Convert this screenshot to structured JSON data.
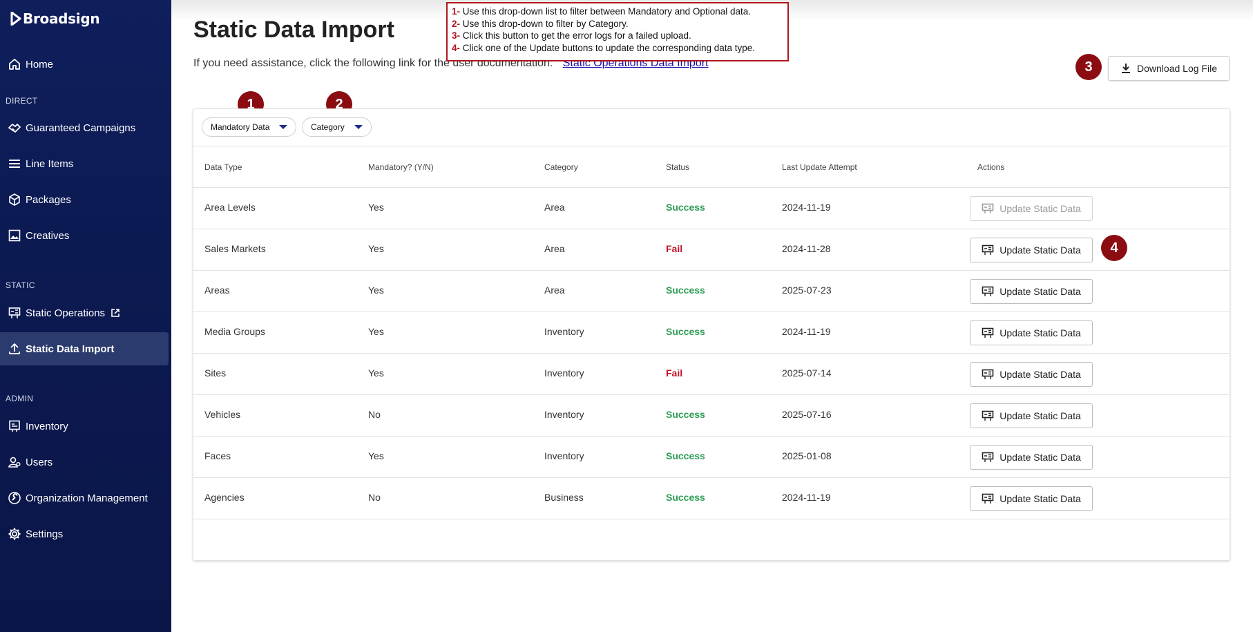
{
  "app": {
    "brand": "Broadsign"
  },
  "sidebar": {
    "home": "Home",
    "section_direct": "DIRECT",
    "direct_items": [
      "Guaranteed Campaigns",
      "Line Items",
      "Packages",
      "Creatives"
    ],
    "section_static": "STATIC",
    "static_items": [
      "Static Operations",
      "Static Data Import"
    ],
    "section_admin": "ADMIN",
    "admin_items": [
      "Inventory",
      "Users",
      "Organization Management",
      "Settings"
    ]
  },
  "page": {
    "title": "Static Data Import",
    "assist_text": "If you need assistance, click the following link for the user documentation:",
    "assist_link": "Static Operations Data Import",
    "download_label": "Download Log File"
  },
  "callout": {
    "lines": [
      {
        "num": "1-",
        "text": " Use this drop-down list to filter between Mandatory and Optional data."
      },
      {
        "num": "2-",
        "text": " Use this drop-down to filter by Category."
      },
      {
        "num": "3-",
        "text": " Click this button to get the error logs for a failed upload."
      },
      {
        "num": "4-",
        "text": " Click one of the Update buttons to update the corresponding data type."
      }
    ],
    "badges": [
      "1",
      "2",
      "3",
      "4"
    ]
  },
  "filters": {
    "mandatory": "Mandatory Data",
    "category": "Category"
  },
  "table": {
    "headers": [
      "Data Type",
      "Mandatory? (Y/N)",
      "Category",
      "Status",
      "Last Update Attempt",
      "Actions"
    ],
    "action_label": "Update Static Data",
    "rows": [
      {
        "type": "Area Levels",
        "mandatory": "Yes",
        "category": "Area",
        "status": "Success",
        "date": "2024-11-19",
        "disabled": true
      },
      {
        "type": "Sales Markets",
        "mandatory": "Yes",
        "category": "Area",
        "status": "Fail",
        "date": "2024-11-28",
        "disabled": false
      },
      {
        "type": "Areas",
        "mandatory": "Yes",
        "category": "Area",
        "status": "Success",
        "date": "2025-07-23",
        "disabled": false
      },
      {
        "type": "Media Groups",
        "mandatory": "Yes",
        "category": "Inventory",
        "status": "Success",
        "date": "2024-11-19",
        "disabled": false
      },
      {
        "type": "Sites",
        "mandatory": "Yes",
        "category": "Inventory",
        "status": "Fail",
        "date": "2025-07-14",
        "disabled": false
      },
      {
        "type": "Vehicles",
        "mandatory": "No",
        "category": "Inventory",
        "status": "Success",
        "date": "2025-07-16",
        "disabled": false
      },
      {
        "type": "Faces",
        "mandatory": "Yes",
        "category": "Inventory",
        "status": "Success",
        "date": "2025-01-08",
        "disabled": false
      },
      {
        "type": "Agencies",
        "mandatory": "No",
        "category": "Business",
        "status": "Success",
        "date": "2024-11-19",
        "disabled": false
      }
    ]
  },
  "colors": {
    "sidebar": "#0f1f5c",
    "success": "#2e9c55",
    "fail": "#c0142a",
    "badge": "#8b0d12"
  }
}
